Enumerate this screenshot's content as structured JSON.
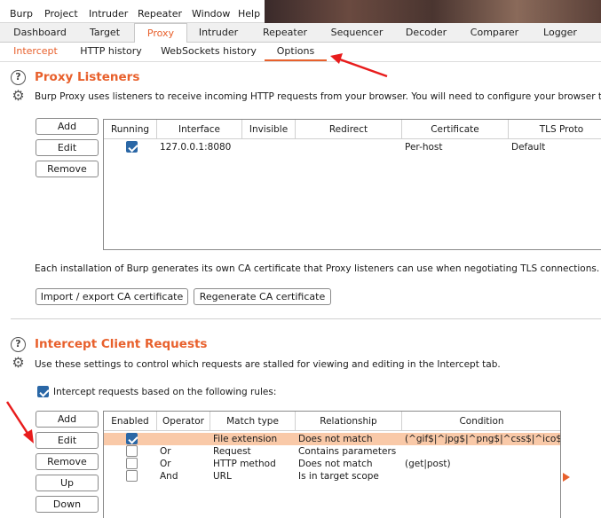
{
  "menu": [
    "Burp",
    "Project",
    "Intruder",
    "Repeater",
    "Window",
    "Help"
  ],
  "main_tabs": [
    "Dashboard",
    "Target",
    "Proxy",
    "Intruder",
    "Repeater",
    "Sequencer",
    "Decoder",
    "Comparer",
    "Logger"
  ],
  "sub_tabs": [
    "Intercept",
    "HTTP history",
    "WebSockets history",
    "Options"
  ],
  "proxy_listeners": {
    "title": "Proxy Listeners",
    "description": "Burp Proxy uses listeners to receive incoming HTTP requests from your browser. You will need to configure your browser to use one",
    "buttons": {
      "add": "Add",
      "edit": "Edit",
      "remove": "Remove"
    },
    "columns": [
      "Running",
      "Interface",
      "Invisible",
      "Redirect",
      "Certificate",
      "TLS Proto"
    ],
    "rows": [
      {
        "running": true,
        "interface": "127.0.0.1:8080",
        "invisible": "",
        "redirect": "",
        "certificate": "Per-host",
        "tls": "Default"
      }
    ],
    "ca_text": "Each installation of Burp generates its own CA certificate that Proxy listeners can use when negotiating TLS connections. You can im",
    "import_label": "Import / export CA certificate",
    "regen_label": "Regenerate CA certificate"
  },
  "intercept_client": {
    "title": "Intercept Client Requests",
    "description": "Use these settings to control which requests are stalled for viewing and editing in the Intercept tab.",
    "checkbox_label": "Intercept requests based on the following rules:",
    "checkbox_checked": true,
    "buttons": {
      "add": "Add",
      "edit": "Edit",
      "remove": "Remove",
      "up": "Up",
      "down": "Down"
    },
    "columns": [
      "Enabled",
      "Operator",
      "Match type",
      "Relationship",
      "Condition"
    ],
    "rows": [
      {
        "enabled": true,
        "operator": "",
        "match_type": "File extension",
        "relationship": "Does not match",
        "condition": "(^gif$|^jpg$|^png$|^css$|^ico$|...",
        "selected": true
      },
      {
        "enabled": false,
        "operator": "Or",
        "match_type": "Request",
        "relationship": "Contains parameters",
        "condition": "",
        "selected": false
      },
      {
        "enabled": false,
        "operator": "Or",
        "match_type": "HTTP method",
        "relationship": "Does not match",
        "condition": "(get|post)",
        "selected": false
      },
      {
        "enabled": false,
        "operator": "And",
        "match_type": "URL",
        "relationship": "Is in target scope",
        "condition": "",
        "selected": false
      }
    ]
  },
  "colors": {
    "accent": "#e8602c",
    "selection": "#f9c9a8",
    "checkbox": "#2a67a6",
    "annotation_arrow": "#e81c1c"
  }
}
